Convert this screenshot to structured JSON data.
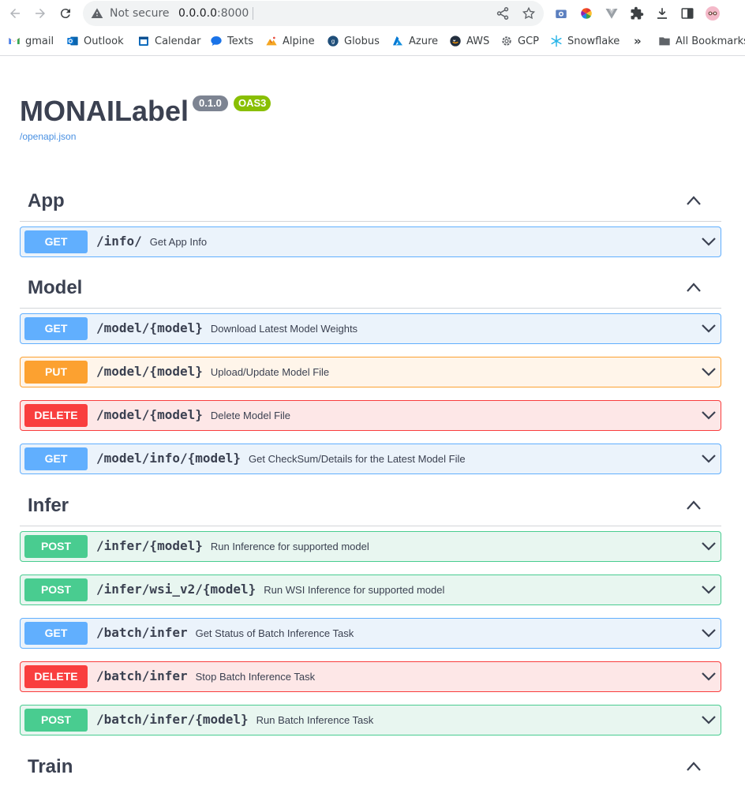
{
  "browser": {
    "security_label": "Not secure",
    "url_host": "0.0.0.0",
    "url_port": ":8000",
    "bookmarks": [
      {
        "label": "gmail"
      },
      {
        "label": "Outlook"
      },
      {
        "label": "Calendar"
      },
      {
        "label": "Texts"
      },
      {
        "label": "Alpine"
      },
      {
        "label": "Globus"
      },
      {
        "label": "Azure"
      },
      {
        "label": "AWS"
      },
      {
        "label": "GCP"
      },
      {
        "label": "Snowflake"
      }
    ],
    "overflow_label": "»",
    "all_bookmarks_label": "All Bookmarks"
  },
  "page": {
    "title": "MONAILabel",
    "version_badge": "0.1.0",
    "oas_badge": "OAS3",
    "openapi_link": "/openapi.json"
  },
  "tags": [
    {
      "name": "App"
    },
    {
      "name": "Model"
    },
    {
      "name": "Infer"
    },
    {
      "name": "Train"
    }
  ],
  "operations": [
    {
      "method": "GET",
      "path": "/info/",
      "summary": "Get App Info"
    },
    {
      "method": "GET",
      "path": "/model/{model}",
      "summary": "Download Latest Model Weights"
    },
    {
      "method": "PUT",
      "path": "/model/{model}",
      "summary": "Upload/Update Model File"
    },
    {
      "method": "DELETE",
      "path": "/model/{model}",
      "summary": "Delete Model File"
    },
    {
      "method": "GET",
      "path": "/model/info/{model}",
      "summary": "Get CheckSum/Details for the Latest Model File"
    },
    {
      "method": "POST",
      "path": "/infer/{model}",
      "summary": "Run Inference for supported model"
    },
    {
      "method": "POST",
      "path": "/infer/wsi_v2/{model}",
      "summary": "Run WSI Inference for supported model"
    },
    {
      "method": "GET",
      "path": "/batch/infer",
      "summary": "Get Status of Batch Inference Task"
    },
    {
      "method": "DELETE",
      "path": "/batch/infer",
      "summary": "Stop Batch Inference Task"
    },
    {
      "method": "POST",
      "path": "/batch/infer/{model}",
      "summary": "Run Batch Inference Task"
    }
  ],
  "colors": {
    "get": "#61affe",
    "put": "#fca130",
    "delete": "#f93e3e",
    "post": "#49cc90",
    "oas": "#89bf04",
    "version": "#7d8492"
  }
}
